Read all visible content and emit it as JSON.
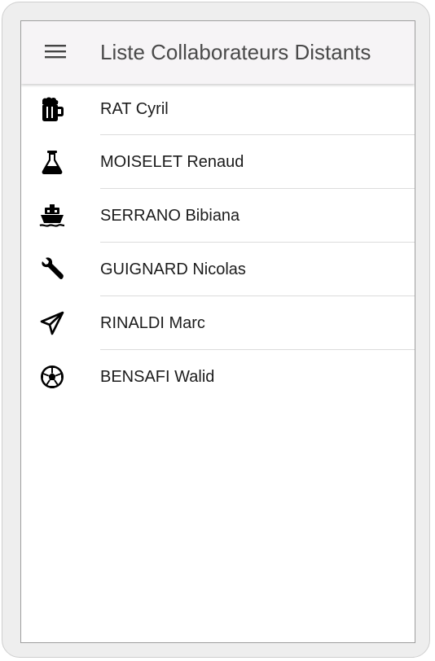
{
  "app_bar": {
    "title": "Liste Collaborateurs Distants",
    "menu_icon": "menu-icon"
  },
  "collaborators": [
    {
      "name": "RAT Cyril",
      "icon": "beer-mug-icon"
    },
    {
      "name": "MOISELET Renaud",
      "icon": "flask-icon"
    },
    {
      "name": "SERRANO Bibiana",
      "icon": "ship-icon"
    },
    {
      "name": "GUIGNARD Nicolas",
      "icon": "wrench-icon"
    },
    {
      "name": "RINALDI Marc",
      "icon": "paper-plane-icon"
    },
    {
      "name": "BENSAFI Walid",
      "icon": "soccer-ball-icon"
    }
  ],
  "colors": {
    "app_bar_background": "#f6f4f6",
    "title_text": "#4a4a4a",
    "item_text": "#1c1c1c",
    "icon": "#000000",
    "divider": "#dcdcdc"
  }
}
